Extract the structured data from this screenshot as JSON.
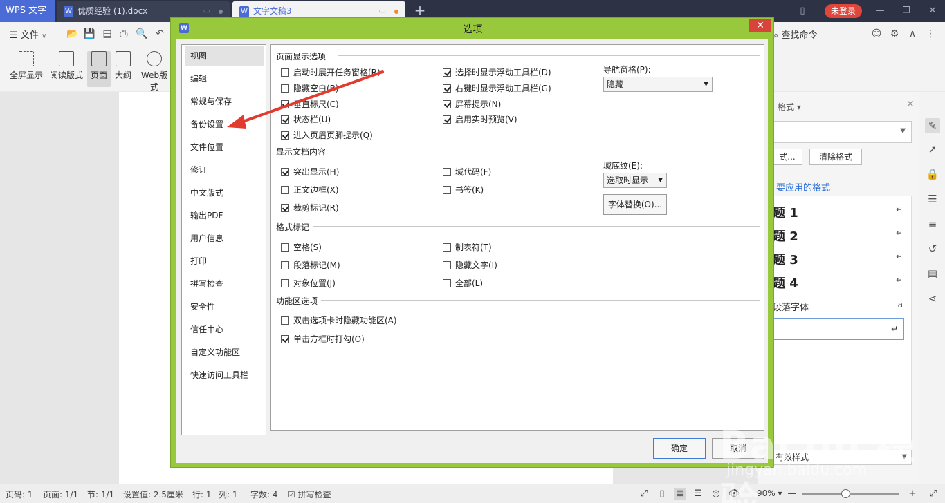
{
  "tabbar": {
    "app_label": "WPS 文字",
    "tabs": [
      {
        "label": "优质经验 (1).docx"
      },
      {
        "label": "文字文稿3"
      }
    ],
    "login_label": "未登录"
  },
  "menubar": {
    "file_label": "文件",
    "find_label": "查找命令"
  },
  "ribbon": {
    "items": [
      {
        "label": "全屏显示"
      },
      {
        "label": "阅读版式"
      },
      {
        "label": "页面"
      },
      {
        "label": "大纲"
      },
      {
        "label": "Web版式"
      }
    ]
  },
  "style_panel": {
    "title": "格式",
    "btn_format": "式...",
    "btn_clear": "清除格式",
    "link": "要应用的格式",
    "headings": [
      {
        "text": "题 1"
      },
      {
        "text": "题 2"
      },
      {
        "text": "题 3"
      },
      {
        "text": "题 4"
      }
    ],
    "para_font": "段落字体",
    "para_font_mark": "a",
    "return_mark": "↵",
    "bottom_dropdown": "有效样式"
  },
  "statusbar": {
    "page_code": "页码: 1",
    "page": "页面: 1/1",
    "section": "节: 1/1",
    "setting": "设置值: 2.5厘米",
    "row": "行: 1",
    "col": "列: 1",
    "chars": "字数: 4",
    "spell": "拼写检查",
    "zoom": "90%"
  },
  "dialog": {
    "title": "选项",
    "nav_items": [
      {
        "label": "视图"
      },
      {
        "label": "编辑"
      },
      {
        "label": "常规与保存"
      },
      {
        "label": "备份设置"
      },
      {
        "label": "文件位置"
      },
      {
        "label": "修订"
      },
      {
        "label": "中文版式"
      },
      {
        "label": "输出PDF"
      },
      {
        "label": "用户信息"
      },
      {
        "label": "打印"
      },
      {
        "label": "拼写检查"
      },
      {
        "label": "安全性"
      },
      {
        "label": "信任中心"
      },
      {
        "label": "自定义功能区"
      },
      {
        "label": "快速访问工具栏"
      }
    ],
    "sections": {
      "page_display": "页面显示选项",
      "doc_content": "显示文档内容",
      "format_marks": "格式标记",
      "ribbon_opts": "功能区选项"
    },
    "checkboxes": [
      {
        "label": "启动时展开任务窗格(R)",
        "checked": false
      },
      {
        "label": "隐藏空白(B)",
        "checked": false
      },
      {
        "label": "垂直标尺(C)",
        "checked": true
      },
      {
        "label": "状态栏(U)",
        "checked": true
      },
      {
        "label": "进入页眉页脚提示(Q)",
        "checked": true
      },
      {
        "label": "选择时显示浮动工具栏(D)",
        "checked": true
      },
      {
        "label": "右键时显示浮动工具栏(G)",
        "checked": true
      },
      {
        "label": "屏幕提示(N)",
        "checked": true
      },
      {
        "label": "启用实时预览(V)",
        "checked": true
      },
      {
        "label": "突出显示(H)",
        "checked": true
      },
      {
        "label": "正文边框(X)",
        "checked": false
      },
      {
        "label": "裁剪标记(R)",
        "checked": true
      },
      {
        "label": "域代码(F)",
        "checked": false
      },
      {
        "label": "书签(K)",
        "checked": false
      },
      {
        "label": "空格(S)",
        "checked": false
      },
      {
        "label": "段落标记(M)",
        "checked": false
      },
      {
        "label": "对象位置(J)",
        "checked": false
      },
      {
        "label": "制表符(T)",
        "checked": false
      },
      {
        "label": "隐藏文字(I)",
        "checked": false
      },
      {
        "label": "全部(L)",
        "checked": false
      },
      {
        "label": "双击选项卡时隐藏功能区(A)",
        "checked": false
      },
      {
        "label": "单击方框时打勾(O)",
        "checked": true
      }
    ],
    "nav_pane_label": "导航窗格(P):",
    "nav_pane_value": "隐藏",
    "field_shading_label": "域底纹(E):",
    "field_shading_value": "选取时显示",
    "font_sub_button": "字体替换(O)...",
    "ok_button": "确定",
    "cancel_button": "取消"
  },
  "watermark": {
    "text": "Bai du 经验",
    "sub": "jingyan.baidu.com"
  },
  "colors": {
    "dialog_border": "#98c93c",
    "app_tab": "#4b6bd6",
    "login": "#e0463b",
    "close": "#d9443a",
    "arrow": "#e23a2e"
  }
}
